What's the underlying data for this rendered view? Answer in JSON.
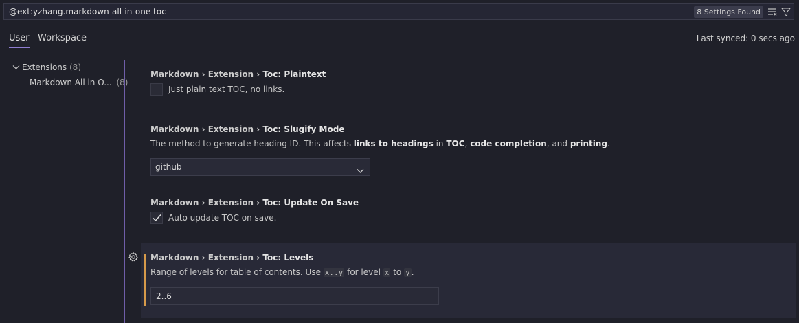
{
  "search": {
    "query": "@ext:yzhang.markdown-all-in-one toc",
    "found_badge": "8 Settings Found"
  },
  "icons": {
    "clear_filter": "clear-filter-icon",
    "filter": "filter-icon",
    "chevron": "chevron-down-icon",
    "gear": "gear-icon",
    "check": "check-icon"
  },
  "tabs": [
    {
      "label": "User",
      "active": true
    },
    {
      "label": "Workspace",
      "active": false
    }
  ],
  "sync_status": "Last synced: 0 secs ago",
  "sidebar": {
    "items": [
      {
        "label": "Extensions",
        "count": "(8)"
      },
      {
        "label": "Markdown All in O...",
        "count": "(8)"
      }
    ]
  },
  "settings": {
    "plaintext": {
      "prefix": "Markdown › Extension › ",
      "key": "Toc: Plaintext",
      "checkbox_label": "Just plain text TOC, no links.",
      "checked": false
    },
    "slugify": {
      "prefix": "Markdown › Extension › ",
      "key": "Toc: Slugify Mode",
      "desc_1": "The method to generate heading ID. This affects ",
      "desc_b1": "links to headings",
      "desc_2": " in ",
      "desc_b2": "TOC",
      "desc_3": ", ",
      "desc_b3": "code completion",
      "desc_4": ", and ",
      "desc_b4": "printing",
      "desc_5": ".",
      "value": "github"
    },
    "update_on_save": {
      "prefix": "Markdown › Extension › ",
      "key": "Toc: Update On Save",
      "checkbox_label": "Auto update TOC on save.",
      "checked": true
    },
    "levels": {
      "prefix": "Markdown › Extension › ",
      "key": "Toc: Levels",
      "desc_1": "Range of levels for table of contents. Use ",
      "code_1": "x..y",
      "desc_2": " for level ",
      "code_2": "x",
      "desc_3": " to ",
      "code_3": "y",
      "desc_4": ".",
      "value": "2..6"
    }
  },
  "colors": {
    "accent": "#6f5ea8",
    "focus_bar": "#d69a4a",
    "background": "#1f2029"
  }
}
